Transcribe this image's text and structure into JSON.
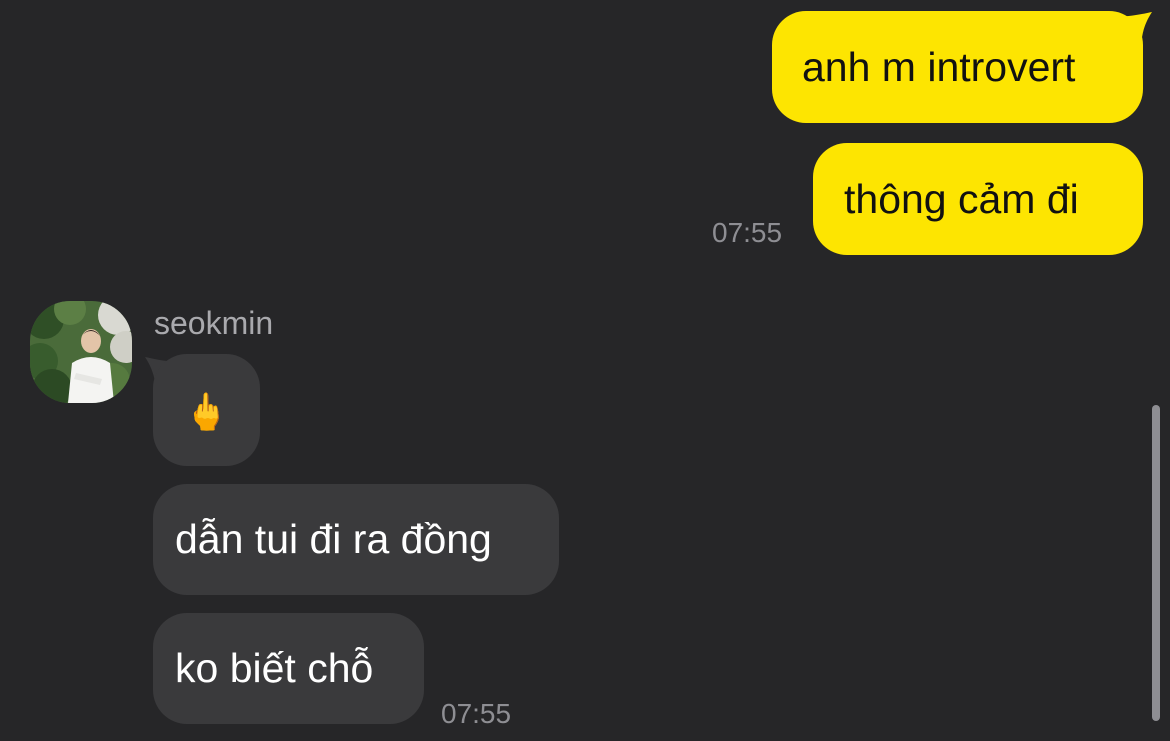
{
  "messages": {
    "sent": [
      {
        "text": "anh m introvert"
      },
      {
        "text": "thông cảm đi"
      }
    ],
    "sent_time": "07:55",
    "sender_name": "seokmin",
    "received": [
      {
        "text": "🖕"
      },
      {
        "text": "dẫn tui đi ra đồng"
      },
      {
        "text": "ko biết chỗ"
      }
    ],
    "received_time": "07:55"
  },
  "colors": {
    "background": "#262628",
    "sent_bubble": "#fde501",
    "received_bubble": "#3a3a3c",
    "timestamp": "#8e8e93"
  },
  "icons": {
    "avatar": "profile-photo",
    "reaction": "middle-finger-emoji"
  }
}
